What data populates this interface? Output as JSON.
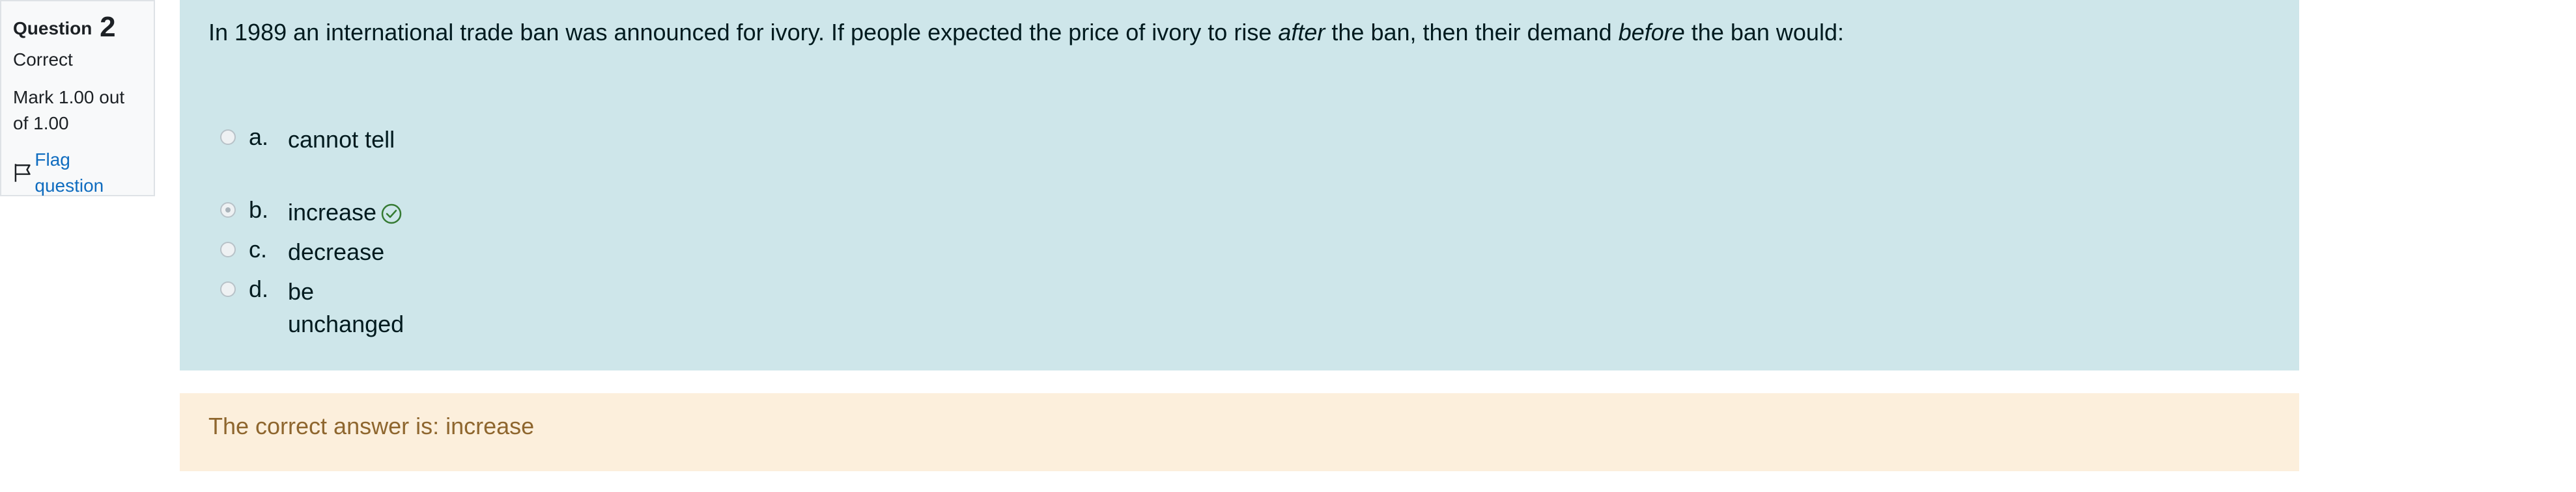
{
  "info": {
    "question_word": "Question",
    "question_number": "2",
    "state": "Correct",
    "grade": "Mark 1.00 out of 1.00",
    "flag_label": "Flag question",
    "flag_icon": "flag-icon"
  },
  "question": {
    "text_part1": "In 1989 an international trade ban was announced for ivory. If people expected the price of ivory to rise ",
    "text_em1": "after",
    "text_part2": " the ban, then their demand ",
    "text_em2": "before",
    "text_part3": " the ban would:",
    "options": [
      {
        "letter": "a.",
        "text": "cannot tell",
        "selected": false
      },
      {
        "letter": "b.",
        "text": "increase",
        "selected": true,
        "correct_icon": "check-circle-icon"
      },
      {
        "letter": "c.",
        "text": "decrease",
        "selected": false
      },
      {
        "letter": "d.",
        "text": "be unchanged",
        "selected": false
      }
    ]
  },
  "feedback": {
    "text": "The correct answer is: increase"
  },
  "colors": {
    "content_bg": "#cee6ea",
    "feedback_bg": "#fcefdc",
    "feedback_text": "#8e662e",
    "link": "#0f6cbf",
    "correct_green": "#357a32"
  }
}
